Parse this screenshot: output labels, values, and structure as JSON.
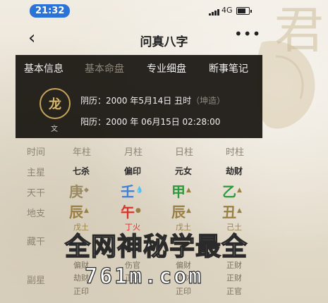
{
  "status_bar": {
    "time": "21:32",
    "network": "4G"
  },
  "nav": {
    "back_icon": "chevron-left-icon",
    "title": "问真八字",
    "more_icon": "more-dots-icon"
  },
  "tabs": [
    {
      "label": "基本信息",
      "active": false
    },
    {
      "label": "基本命盘",
      "active": true
    },
    {
      "label": "专业细盘",
      "active": false
    },
    {
      "label": "断事笔记",
      "active": false
    }
  ],
  "profile": {
    "avatar_glyph": "龙",
    "avatar_sub": "文",
    "lunar_label": "阴历：",
    "lunar_value": "2000 年5月14日 丑时",
    "lunar_gender": "（坤造）",
    "solar_label": "阳历：",
    "solar_value": "2000 年 06月15日 02:28:00"
  },
  "chart": {
    "row_labels": {
      "header": "时间",
      "main_star": "主星",
      "heavenly_stem": "天干",
      "earthly_branch": "地支",
      "hidden_stem": "藏干",
      "sub_star": "副星"
    },
    "columns": [
      "年柱",
      "月柱",
      "日柱",
      "时柱"
    ],
    "main_star": [
      "七杀",
      "偏印",
      "元女",
      "劫财"
    ],
    "heavenly_stem": [
      {
        "char": "庚",
        "element": "metal",
        "color": "#9a8a62"
      },
      {
        "char": "壬",
        "element": "water",
        "color": "#3f7fd8"
      },
      {
        "char": "甲",
        "element": "wood",
        "color": "#2f9a3d"
      },
      {
        "char": "乙",
        "element": "wood",
        "color": "#2f9a3d"
      }
    ],
    "earthly_branch": [
      {
        "char": "辰",
        "element": "earth",
        "color": "#9a7f42"
      },
      {
        "char": "午",
        "element": "fire",
        "color": "#d8322a"
      },
      {
        "char": "辰",
        "element": "earth",
        "color": "#9a7f42"
      },
      {
        "char": "丑",
        "element": "earth",
        "color": "#9a7f42"
      }
    ],
    "hidden_stem": [
      "戊土",
      "丁火",
      "戊土",
      "己土"
    ],
    "sub_star_rows": [
      [
        "偏财",
        "伤官",
        "偏财",
        "正财"
      ],
      [
        "劫财",
        "正财",
        "劫财",
        "正财"
      ],
      [
        "正印",
        "",
        "正印",
        "正官"
      ]
    ]
  },
  "watermark": {
    "line1": "全网神秘学最全",
    "line2": "761m.com"
  }
}
